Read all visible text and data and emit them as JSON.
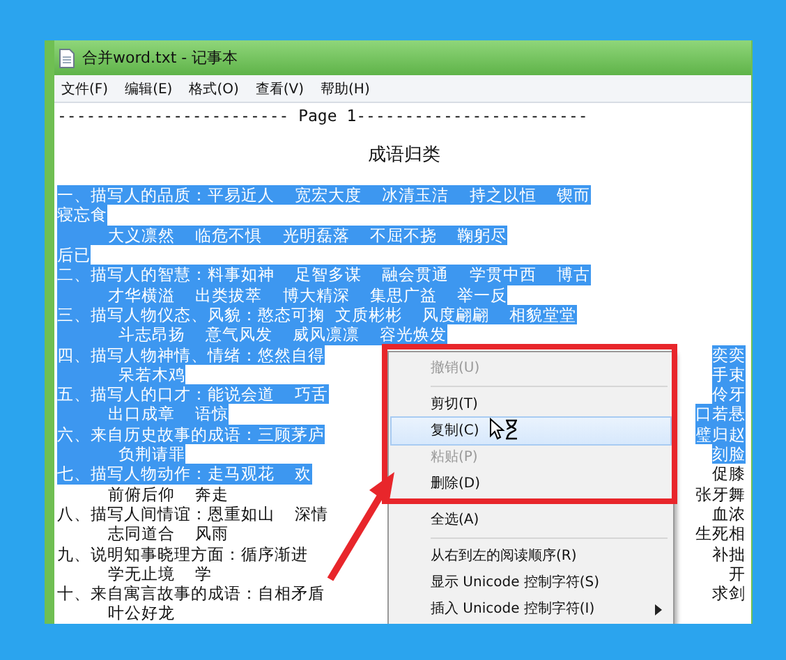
{
  "window": {
    "title": "合并word.txt - 记事本"
  },
  "menu_bar": [
    "文件(F)",
    "编辑(E)",
    "格式(O)",
    "查看(V)",
    "帮助(H)"
  ],
  "document": {
    "header": "------------------------ Page 1------------------------",
    "heading": "成语归类",
    "lines": [
      {
        "text": "一、描写人的品质：平易近人    宽宏大度    冰清玉洁    持之以恒    锲而",
        "selected": true
      },
      {
        "text": "寝忘食",
        "selected": true
      },
      {
        "text": "          大义凛然    临危不惧    光明磊落    不屈不挠    鞠躬尽",
        "selected": true
      },
      {
        "text": "后已",
        "selected": true
      },
      {
        "text": "二、描写人的智慧：料事如神    足智多谋    融会贯通    学贯中西    博古",
        "selected": true
      },
      {
        "text": "          才华横溢    出类拔萃    博大精深    集思广益    举一反",
        "selected": true
      },
      {
        "text": "三、描写人物仪态、风貌：憨态可掬  文质彬彬    风度翩翩    相貌堂堂",
        "selected": true
      },
      {
        "text": "            斗志昂扬    意气风发    威风凛凛    容光焕发",
        "selected": true
      },
      {
        "text": "四、描写人物神情、情绪：悠然自得",
        "right": "奕奕",
        "selected": true
      },
      {
        "text": "            呆若木鸡",
        "right": "手束",
        "selected": true
      },
      {
        "text": "五、描写人的口才：能说会道    巧舌",
        "right": "伶牙",
        "selected": true
      },
      {
        "text": "          出口成章    语惊",
        "right": "口若悬",
        "selected": true
      },
      {
        "text": "六、来自历史故事的成语：三顾茅庐",
        "right": "璧归赵",
        "selected": true
      },
      {
        "text": "            负荆请罪",
        "right": "刻脸",
        "selected": true
      },
      {
        "text": "七、描写人物动作：走马观花    欢",
        "right": "促膝",
        "selected": true
      },
      {
        "text": "          前俯后仰    奔走",
        "right": "张牙舞",
        "selected": false
      },
      {
        "text": "八、描写人间情谊：恩重如山    深情",
        "right": "血浓",
        "selected": false
      },
      {
        "text": "          志同道合    风雨",
        "right": "生死相",
        "selected": false
      },
      {
        "text": "九、说明知事晓理方面：循序渐进",
        "right": "补拙",
        "selected": false
      },
      {
        "text": "          学无止境    学",
        "right": "开",
        "selected": false
      },
      {
        "text": "十、来自寓言故事的成语：自相矛盾",
        "right": "求剑",
        "selected": false
      },
      {
        "text": "          叶公好龙",
        "selected": false
      }
    ]
  },
  "context_menu": {
    "items": [
      {
        "kind": "item",
        "label": "撤销(U)",
        "disabled": true,
        "selected": false
      },
      {
        "kind": "separator"
      },
      {
        "kind": "item",
        "label": "剪切(T)",
        "disabled": false,
        "selected": false
      },
      {
        "kind": "item",
        "label": "复制(C)",
        "disabled": false,
        "selected": true
      },
      {
        "kind": "item",
        "label": "粘贴(P)",
        "disabled": true,
        "selected": false
      },
      {
        "kind": "item",
        "label": "删除(D)",
        "disabled": false,
        "selected": false
      },
      {
        "kind": "separator"
      },
      {
        "kind": "item",
        "label": "全选(A)",
        "disabled": false,
        "selected": false
      },
      {
        "kind": "separator"
      },
      {
        "kind": "item",
        "label": "从右到左的阅读顺序(R)",
        "disabled": false,
        "selected": false
      },
      {
        "kind": "item",
        "label": "显示 Unicode 控制字符(S)",
        "disabled": false,
        "selected": false
      },
      {
        "kind": "submenu",
        "label": "插入 Unicode 控制字符(I)",
        "disabled": false,
        "selected": false
      }
    ]
  }
}
